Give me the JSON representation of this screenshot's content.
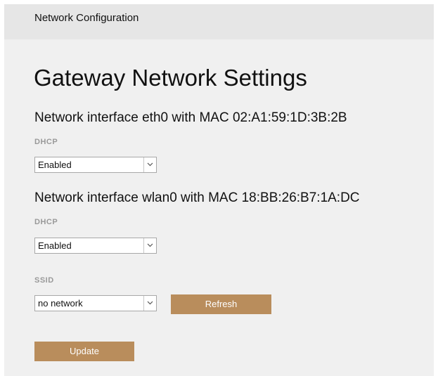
{
  "header": {
    "title": "Network Configuration"
  },
  "page": {
    "title": "Gateway Network Settings"
  },
  "interfaces": [
    {
      "heading": "Network interface eth0 with MAC 02:A1:59:1D:3B:2B",
      "dhcp_label": "DHCP",
      "dhcp_value": "Enabled"
    },
    {
      "heading": "Network interface wlan0 with MAC 18:BB:26:B7:1A:DC",
      "dhcp_label": "DHCP",
      "dhcp_value": "Enabled",
      "ssid_label": "SSID",
      "ssid_value": "no network"
    }
  ],
  "buttons": {
    "refresh_label": "Refresh",
    "update_label": "Update"
  },
  "colors": {
    "accent": "#b98d5c",
    "background": "#f0f0f0",
    "header_background": "#e6e6e6",
    "label_gray": "#999999"
  }
}
